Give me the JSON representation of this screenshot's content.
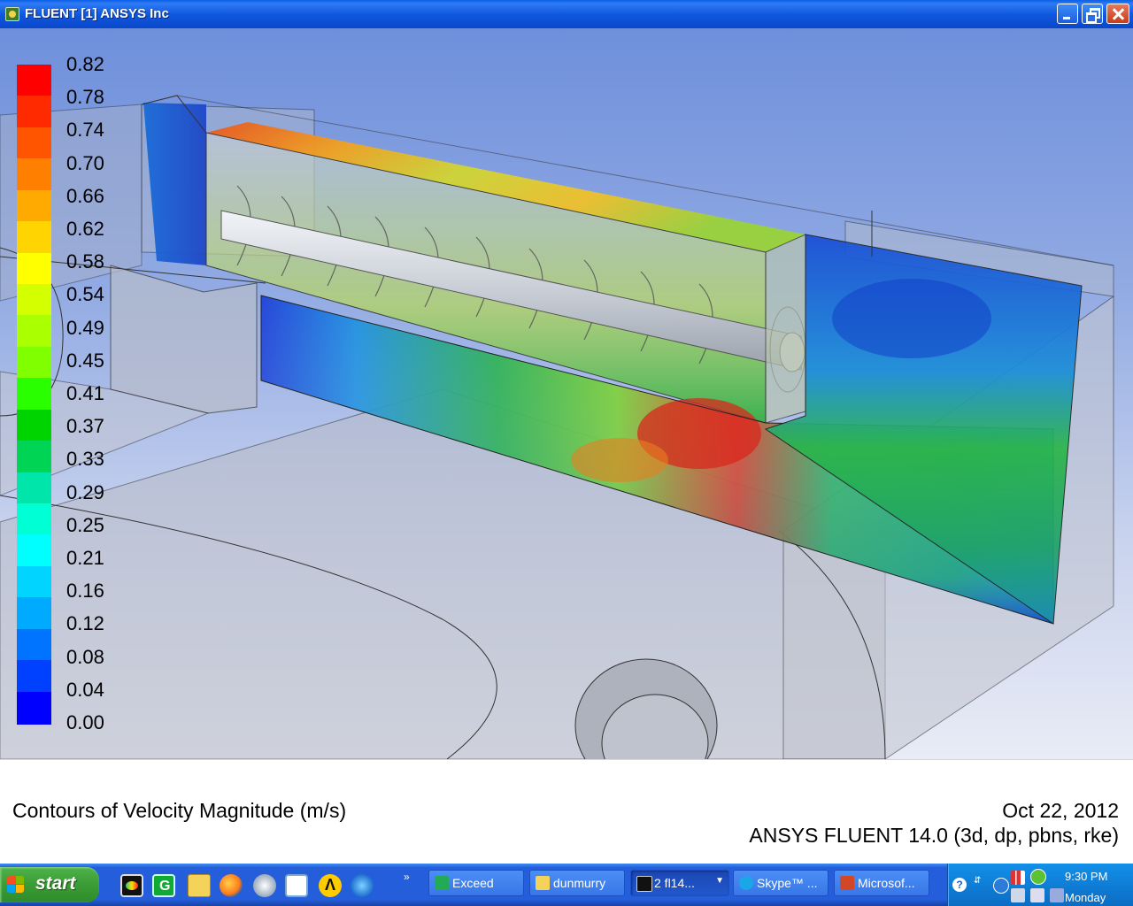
{
  "window": {
    "title": "FLUENT [1] ANSYS Inc",
    "controls": [
      "minimize",
      "maximize",
      "close"
    ]
  },
  "legend": {
    "ticks": [
      "0.82",
      "0.78",
      "0.74",
      "0.70",
      "0.66",
      "0.62",
      "0.58",
      "0.54",
      "0.49",
      "0.45",
      "0.41",
      "0.37",
      "0.33",
      "0.29",
      "0.25",
      "0.21",
      "0.16",
      "0.12",
      "0.08",
      "0.04",
      "0.00"
    ],
    "colors": [
      "#ff0000",
      "#ff2a00",
      "#ff5500",
      "#ff7f00",
      "#ffaa00",
      "#ffd400",
      "#ffff00",
      "#d4ff00",
      "#aaff00",
      "#7fff00",
      "#2aff00",
      "#00d400",
      "#00d455",
      "#00e6aa",
      "#00ffd4",
      "#00ffff",
      "#00d4ff",
      "#00aaff",
      "#0073ff",
      "#0040ff",
      "#0000ff"
    ]
  },
  "caption": {
    "title": "Contours of Velocity Magnitude (m/s)",
    "date": "Oct 22, 2012",
    "version": "ANSYS FLUENT 14.0 (3d, dp, pbns, rke)"
  },
  "taskbar": {
    "start_label": "start",
    "quick_launch": [
      "exceed-icon",
      "ghostscript-icon",
      "folder-icon",
      "firefox-icon",
      "network-icon",
      "editor-icon",
      "ansys-icon",
      "ie-icon"
    ],
    "tasks": [
      {
        "label": "Exceed",
        "icon": "exceed-icon",
        "active": false
      },
      {
        "label": "dunmurry",
        "icon": "folder-icon",
        "active": false
      },
      {
        "label": "2 fl14...",
        "icon": "fluent-icon",
        "active": true
      },
      {
        "label": "Skype™ ...",
        "icon": "skype-icon",
        "active": false
      },
      {
        "label": "Microsof...",
        "icon": "powerpoint-icon",
        "active": false
      }
    ],
    "clock_time": "9:30 PM",
    "clock_day": "Monday"
  }
}
